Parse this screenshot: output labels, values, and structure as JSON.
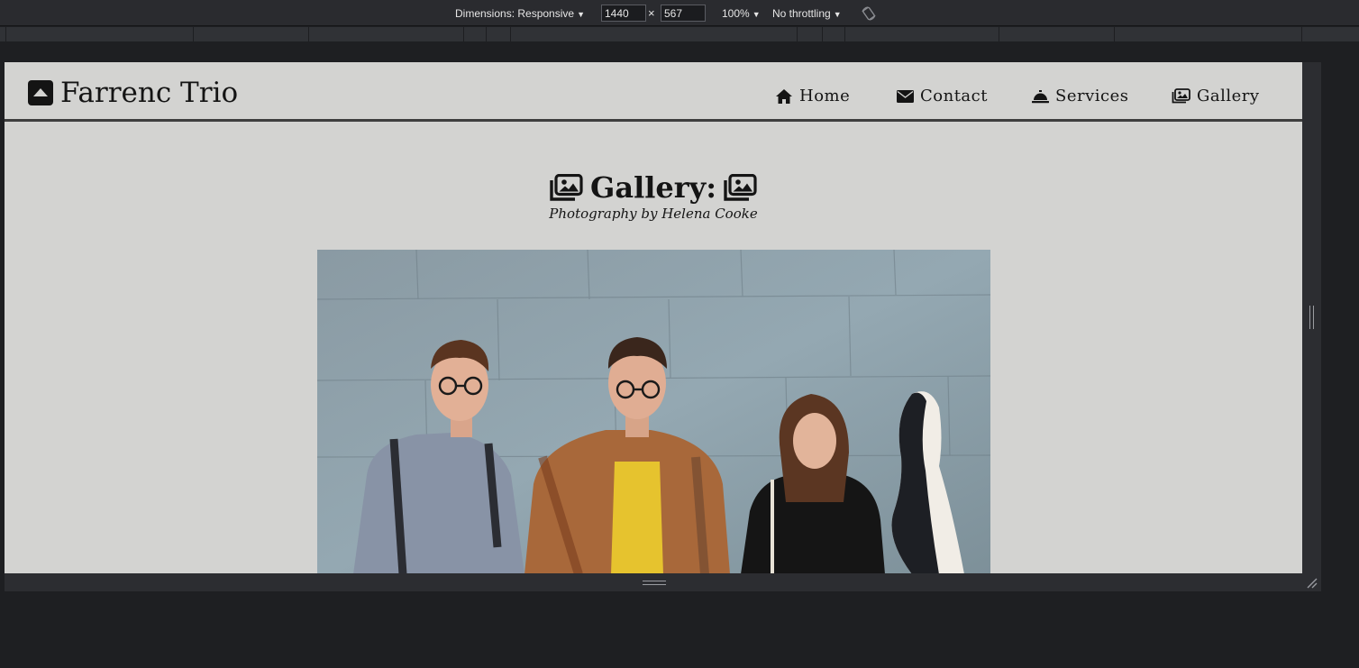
{
  "devtools": {
    "dimensions_label": "Dimensions: Responsive",
    "width_value": "1440",
    "height_value": "567",
    "separator": "×",
    "zoom_label": "100%",
    "throttle_label": "No throttling"
  },
  "site": {
    "brand": "Farrenc Trio",
    "nav": [
      {
        "label": "Home",
        "icon": "home-icon"
      },
      {
        "label": "Contact",
        "icon": "envelope-icon"
      },
      {
        "label": "Services",
        "icon": "concierge-bell-icon"
      },
      {
        "label": "Gallery",
        "icon": "images-icon"
      }
    ],
    "gallery_title": "Gallery:",
    "gallery_subtitle": "Photography by Helena Cooke",
    "photo_alt": "Three musicians standing in front of a grey-blue wall with a cello case"
  },
  "colors": {
    "page_bg": "#d3d3d1",
    "text": "#141414",
    "devtools_bg": "#1e1f22",
    "header_border": "#3e3e3e"
  }
}
